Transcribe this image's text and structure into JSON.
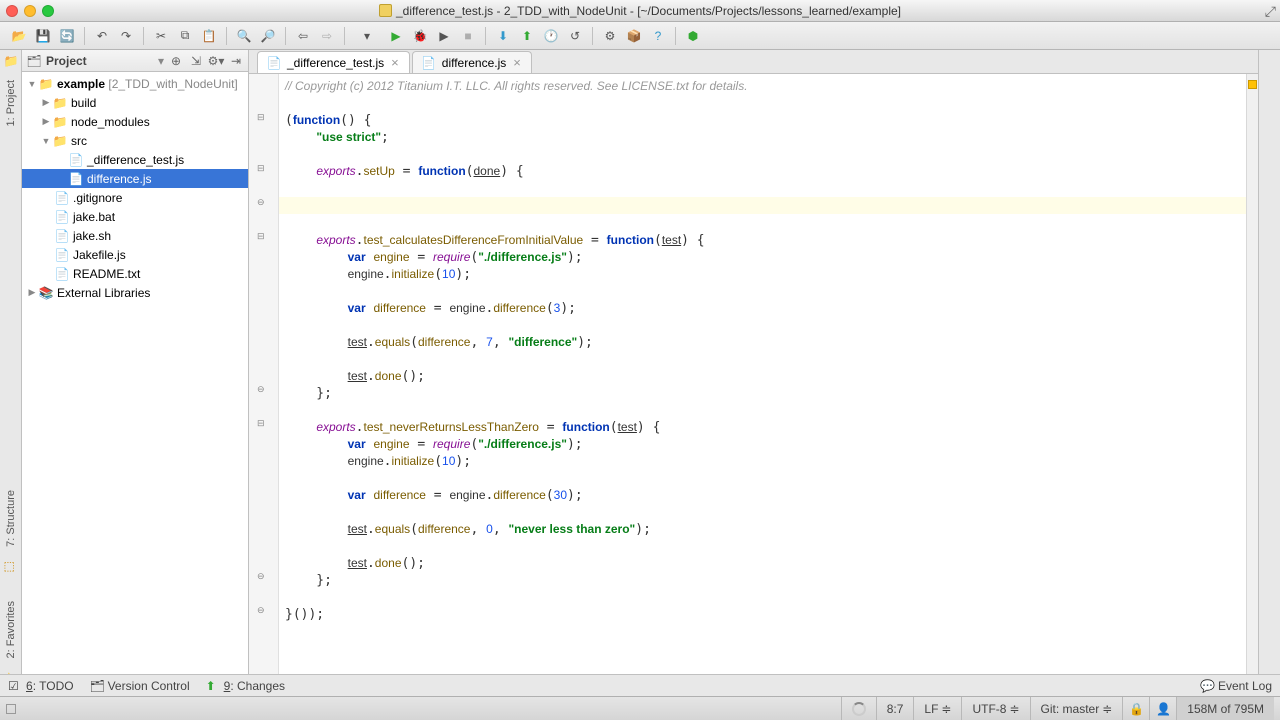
{
  "window": {
    "title": "_difference_test.js - 2_TDD_with_NodeUnit - [~/Documents/Projects/lessons_learned/example]"
  },
  "rails": {
    "project": "1: Project",
    "structure": "7: Structure",
    "favorites": "2: Favorites"
  },
  "projectPanel": {
    "title": "Project"
  },
  "tree": {
    "root": "example",
    "rootHint": "[2_TDD_with_NodeUnit]",
    "build": "build",
    "node_modules": "node_modules",
    "src": "src",
    "diff_test": "_difference_test.js",
    "diff": "difference.js",
    "gitignore": ".gitignore",
    "jakebat": "jake.bat",
    "jakesh": "jake.sh",
    "jakefile": "Jakefile.js",
    "readme": "README.txt",
    "extlib": "External Libraries"
  },
  "tabs": {
    "t1": "_difference_test.js",
    "t2": "difference.js"
  },
  "code": {
    "comment": "// Copyright (c) 2012 Titanium I.T. LLC. All rights reserved. See LICENSE.txt for details.",
    "use_strict": "\"use strict\"",
    "setUp": "setUp",
    "done": "done",
    "test1": "test_calculatesDifferenceFromInitialValue",
    "test2": "test_neverReturnsLessThanZero",
    "test": "test",
    "engine": "engine",
    "require": "require",
    "reqpath": "\"./difference.js\"",
    "initialize": "initialize",
    "ten": "10",
    "difference": "difference",
    "three": "3",
    "seven": "7",
    "thirty": "30",
    "zero": "0",
    "equals": "equals",
    "donefn": "done",
    "msg1": "\"difference\"",
    "msg2": "\"never less than zero\"",
    "var": "var",
    "function": "function",
    "exports": "exports"
  },
  "bottom": {
    "todo": "6: TODO",
    "vcs": "Version Control",
    "changes": "9: Changes",
    "eventlog": "Event Log"
  },
  "status": {
    "pos": "8:7",
    "lf": "LF",
    "enc": "UTF-8",
    "git": "Git: master",
    "mem": "158M of 795M"
  }
}
